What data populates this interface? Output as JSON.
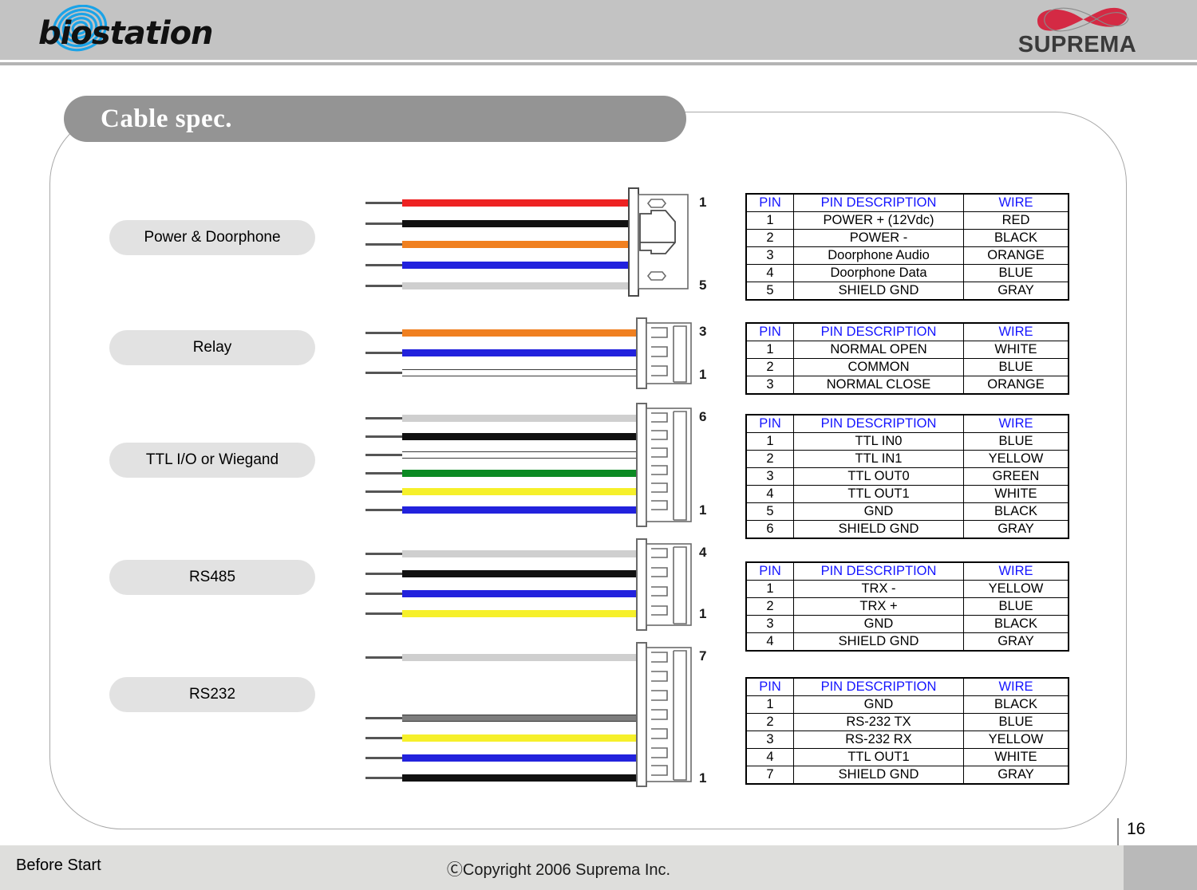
{
  "header": {
    "product_logo_text": "biostation",
    "product_logo_icon": "fingerprint-icon",
    "company_logo_text": "SUPREMA",
    "company_logo_icon": "infinity-ribbon-icon"
  },
  "section": {
    "title": "Cable spec."
  },
  "labels": [
    {
      "text": "Power & Doorphone"
    },
    {
      "text": "Relay"
    },
    {
      "text": "TTL I/O or Wiegand"
    },
    {
      "text": "RS485"
    },
    {
      "text": "RS232"
    }
  ],
  "cables": [
    {
      "name": "power-doorphone-cable",
      "top_pin": "1",
      "bottom_pin": "5",
      "connector_type": "power-plug",
      "wires": [
        "#ee2222",
        "#111111",
        "#f08020",
        "#2222dd",
        "#cfcfcf"
      ]
    },
    {
      "name": "relay-cable",
      "top_pin": "3",
      "bottom_pin": "1",
      "connector_type": "comb-3",
      "wires": [
        "#f08020",
        "#2222dd",
        "#ffffff"
      ]
    },
    {
      "name": "ttl-io-cable",
      "top_pin": "6",
      "bottom_pin": "1",
      "connector_type": "comb-6",
      "wires": [
        "#cfcfcf",
        "#111111",
        "#ffffff",
        "#0b8a23",
        "#f6f02a",
        "#2222dd"
      ]
    },
    {
      "name": "rs485-cable",
      "top_pin": "4",
      "bottom_pin": "1",
      "connector_type": "comb-4",
      "wires": [
        "#cfcfcf",
        "#111111",
        "#2222dd",
        "#f6f02a"
      ]
    },
    {
      "name": "rs232-cable",
      "top_pin": "7",
      "bottom_pin": "1",
      "connector_type": "comb-7",
      "wires": [
        "#cfcfcf",
        "#7d7d7d",
        "#f6f02a",
        "#2222dd",
        "#111111"
      ]
    }
  ],
  "tables": [
    {
      "name": "power-doorphone-table",
      "headers": [
        "PIN",
        "PIN DESCRIPTION",
        "WIRE"
      ],
      "rows": [
        [
          "1",
          "POWER + (12Vdc)",
          "RED"
        ],
        [
          "2",
          "POWER -",
          "BLACK"
        ],
        [
          "3",
          "Doorphone Audio",
          "ORANGE"
        ],
        [
          "4",
          "Doorphone Data",
          "BLUE"
        ],
        [
          "5",
          "SHIELD GND",
          "GRAY"
        ]
      ]
    },
    {
      "name": "relay-table",
      "headers": [
        "PIN",
        "PIN DESCRIPTION",
        "WIRE"
      ],
      "rows": [
        [
          "1",
          "NORMAL OPEN",
          "WHITE"
        ],
        [
          "2",
          "COMMON",
          "BLUE"
        ],
        [
          "3",
          "NORMAL CLOSE",
          "ORANGE"
        ]
      ]
    },
    {
      "name": "ttl-io-table",
      "headers": [
        "PIN",
        "PIN DESCRIPTION",
        "WIRE"
      ],
      "rows": [
        [
          "1",
          "TTL IN0",
          "BLUE"
        ],
        [
          "2",
          "TTL IN1",
          "YELLOW"
        ],
        [
          "3",
          "TTL OUT0",
          "GREEN"
        ],
        [
          "4",
          "TTL OUT1",
          "WHITE"
        ],
        [
          "5",
          "GND",
          "BLACK"
        ],
        [
          "6",
          "SHIELD GND",
          "GRAY"
        ]
      ]
    },
    {
      "name": "rs485-table",
      "headers": [
        "PIN",
        "PIN DESCRIPTION",
        "WIRE"
      ],
      "rows": [
        [
          "1",
          "TRX -",
          "YELLOW"
        ],
        [
          "2",
          "TRX +",
          "BLUE"
        ],
        [
          "3",
          "GND",
          "BLACK"
        ],
        [
          "4",
          "SHIELD GND",
          "GRAY"
        ]
      ]
    },
    {
      "name": "rs232-table",
      "headers": [
        "PIN",
        "PIN DESCRIPTION",
        "WIRE"
      ],
      "rows": [
        [
          "1",
          "GND",
          "BLACK"
        ],
        [
          "2",
          "RS-232 TX",
          "BLUE"
        ],
        [
          "3",
          "RS-232 RX",
          "YELLOW"
        ],
        [
          "4",
          "TTL OUT1",
          "WHITE"
        ],
        [
          "7",
          "SHIELD GND",
          "GRAY"
        ]
      ]
    }
  ],
  "footer": {
    "left_text": "Before Start",
    "copyright": "ⒸCopyright 2006 Suprema Inc.",
    "page_number": "16"
  },
  "colors": {
    "header_bg": "#c3c3c3",
    "banner_bg": "#949494",
    "pill_bg": "#e2e2e2",
    "footer_bg": "#dededc",
    "footer_accent": "#b9b9b9",
    "table_header_text": "#1414ff",
    "panel_border": "#a8a8a8"
  }
}
